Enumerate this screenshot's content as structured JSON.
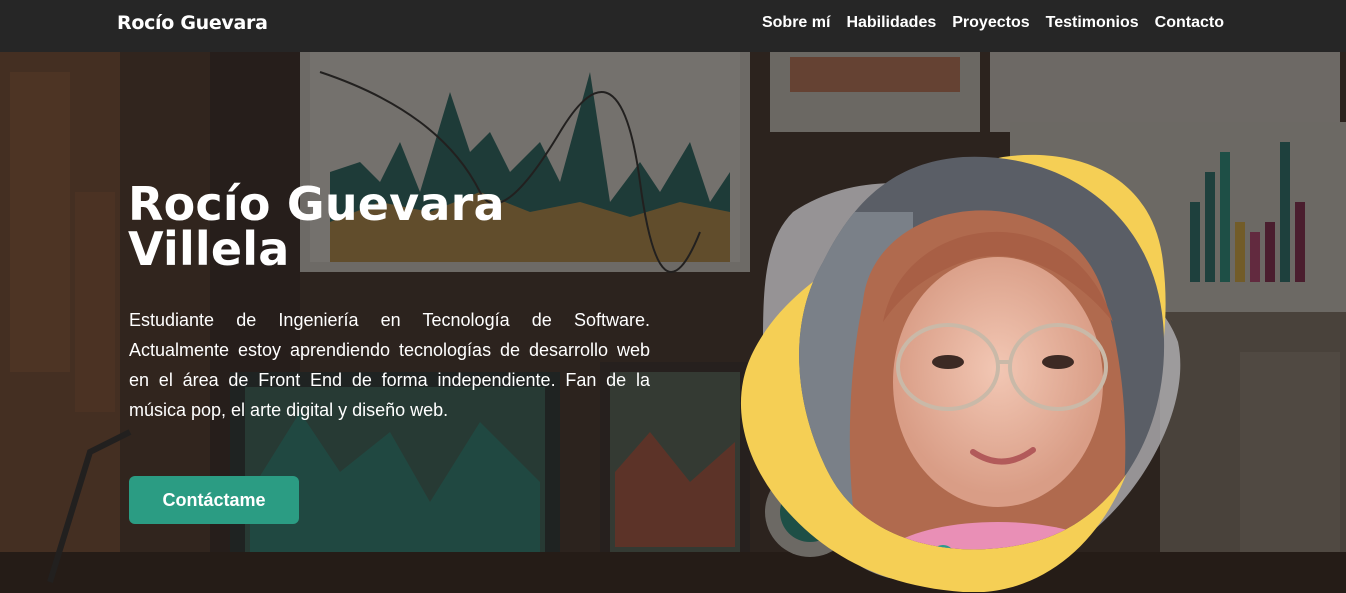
{
  "nav": {
    "brand": "Rocío Guevara",
    "links": [
      "Sobre mí",
      "Habilidades",
      "Proyectos",
      "Testimonios",
      "Contacto"
    ]
  },
  "hero": {
    "title_line1": "Rocío Guevara",
    "title_line2": "Villela",
    "description": "Estudiante de Ingeniería en Tecnología de Software. Actualmente estoy aprendiendo tecnologías de desarrollo web en el área de Front End de forma independiente. Fan de la música pop, el arte digital y diseño web.",
    "cta_label": "Contáctame"
  },
  "colors": {
    "nav_bg": "#262626",
    "accent": "#2b9c83",
    "blob_yellow": "#f5cf55",
    "blob_gray": "#b9b9bd"
  }
}
